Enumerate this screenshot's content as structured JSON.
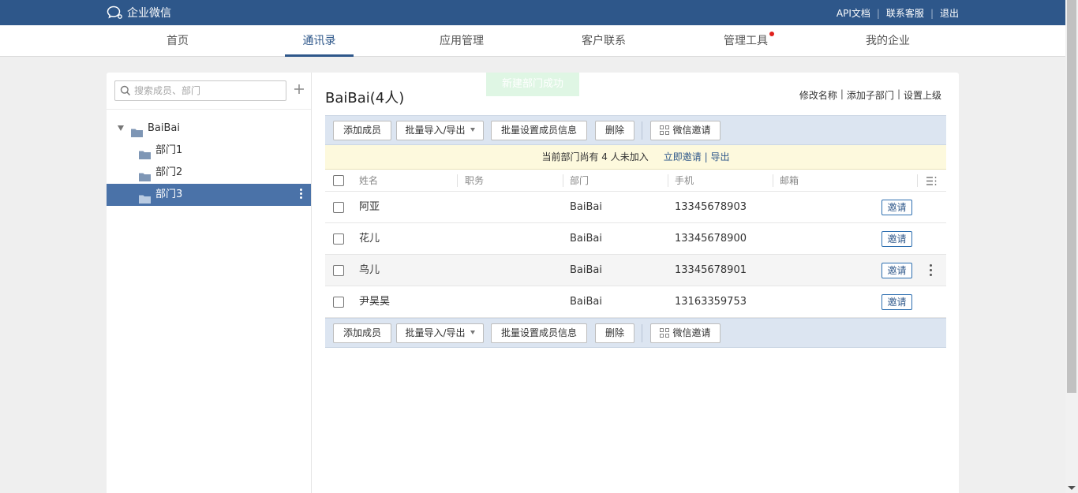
{
  "header": {
    "logo_text": "企业微信",
    "links": [
      "API文档",
      "联系客服",
      "退出"
    ]
  },
  "nav": {
    "tabs": [
      "首页",
      "通讯录",
      "应用管理",
      "客户联系",
      "管理工具",
      "我的企业"
    ],
    "active": "通讯录",
    "notify_dot_tab": "管理工具",
    "notify_color": "#e0201c"
  },
  "colors": {
    "header_bg": "#2e578a",
    "selected_bg": "#4a72a8",
    "toolbar_bg": "#dce5f1",
    "notice_bg": "#fdf9dd"
  },
  "sidebar": {
    "search_placeholder": "搜索成员、部门",
    "tree": {
      "root": "BaiBai",
      "children": [
        "部门1",
        "部门2",
        "部门3"
      ],
      "selected": "部门3"
    }
  },
  "content": {
    "title": "BaiBai(4人)",
    "toast": "新建部门成功",
    "title_links": [
      "修改名称",
      "添加子部门",
      "设置上级"
    ],
    "toolbar": {
      "add_member": "添加成员",
      "batch_import_export": "批量导入/导出",
      "batch_set_info": "批量设置成员信息",
      "delete": "删除",
      "wechat_invite": "微信邀请"
    },
    "notice": {
      "text": "当前部门尚有 4 人未加入",
      "invite_link": "立即邀请",
      "separator": "|",
      "export_link": "导出"
    },
    "table": {
      "columns": [
        "姓名",
        "职务",
        "部门",
        "手机",
        "邮箱"
      ],
      "invite_label": "邀请",
      "rows": [
        {
          "name": "阿亚",
          "title": "",
          "dept": "BaiBai",
          "phone": "13345678903",
          "email": ""
        },
        {
          "name": "花儿",
          "title": "",
          "dept": "BaiBai",
          "phone": "13345678900",
          "email": ""
        },
        {
          "name": "鸟儿",
          "title": "",
          "dept": "BaiBai",
          "phone": "13345678901",
          "email": ""
        },
        {
          "name": "尹昊昊",
          "title": "",
          "dept": "BaiBai",
          "phone": "13163359753",
          "email": ""
        }
      ]
    }
  }
}
